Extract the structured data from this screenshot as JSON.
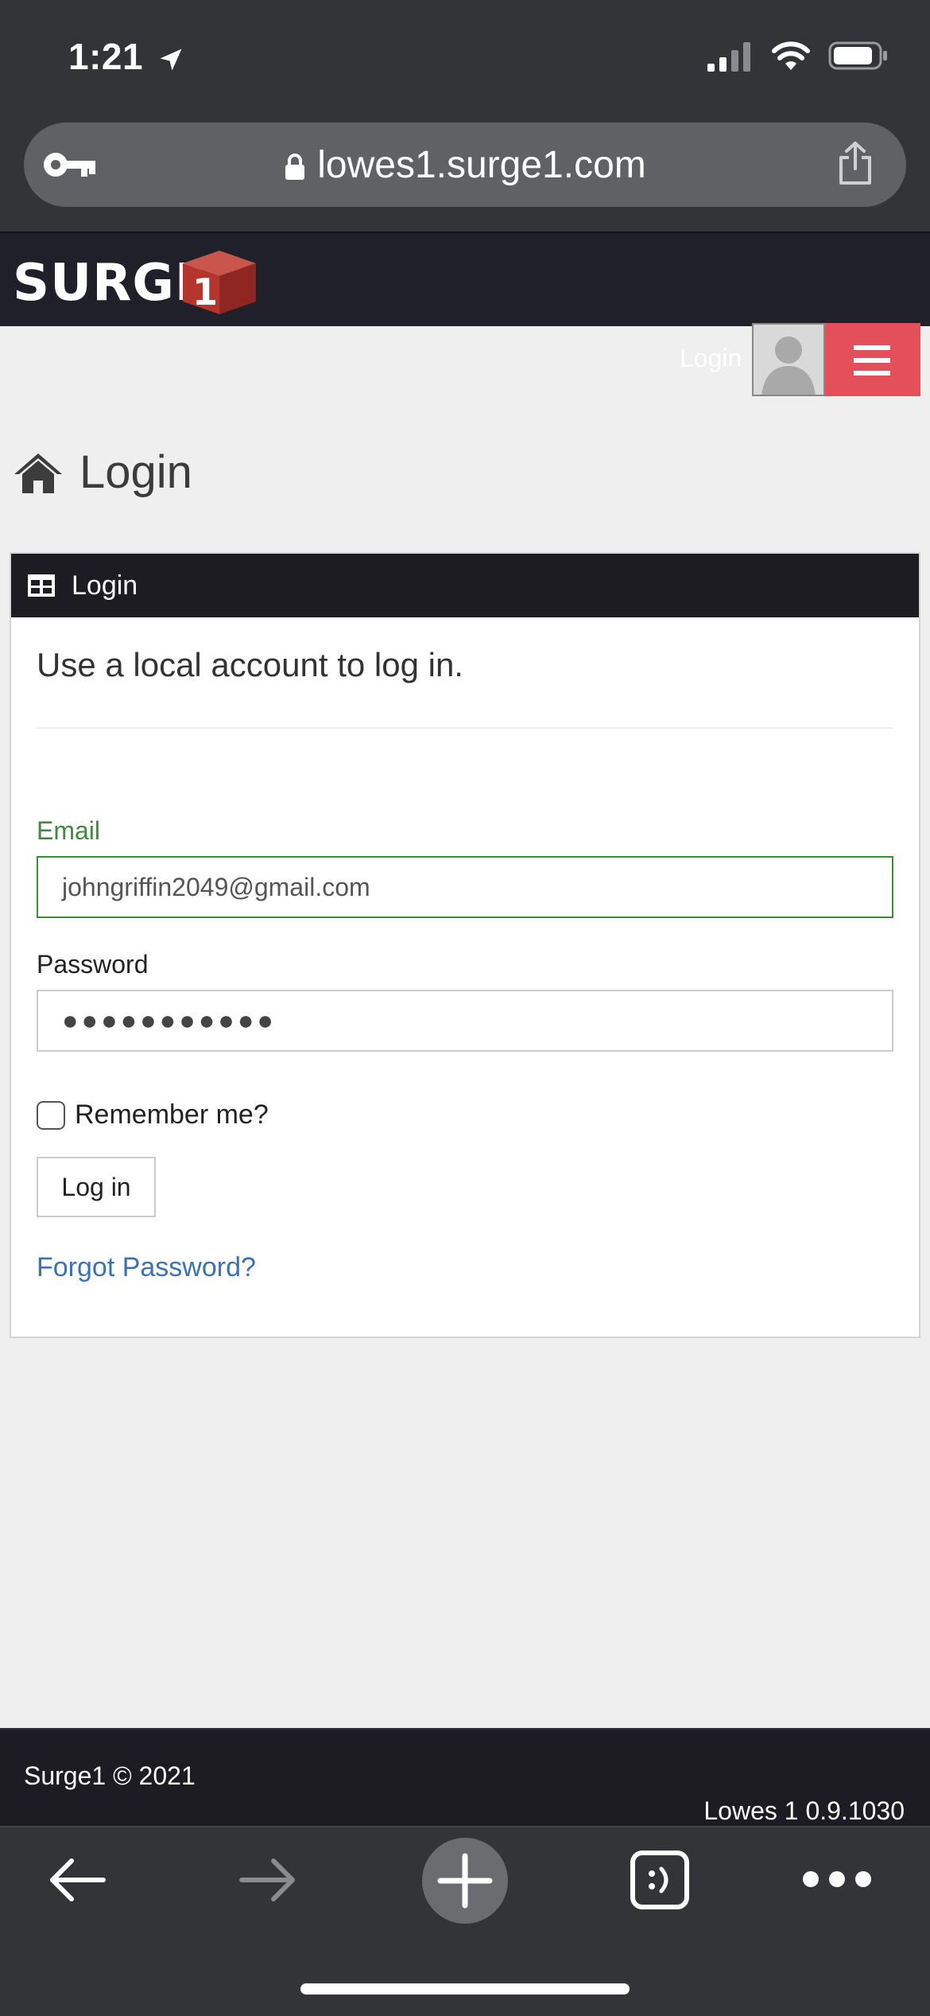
{
  "status_bar": {
    "time": "1:21"
  },
  "browser": {
    "url": "lowes1.surge1.com"
  },
  "site": {
    "logo_text": "SURGE",
    "logo_digit": "1"
  },
  "nav": {
    "login_link": "Login"
  },
  "page": {
    "title": "Login"
  },
  "panel": {
    "heading": "Login",
    "subtitle": "Use a local account to log in.",
    "email_label": "Email",
    "email_value": "johngriffin2049@gmail.com",
    "password_label": "Password",
    "password_value": "●●●●●●●●●●●",
    "remember_label": "Remember me?",
    "login_button": "Log in",
    "forgot_link": "Forgot Password?"
  },
  "footer": {
    "copyright": "Surge1 © 2021",
    "version": "Lowes 1 0.9.1030"
  },
  "colors": {
    "accent_red": "#e3505a",
    "header_dark": "#1f2029",
    "email_green": "#3f8a3b",
    "link_blue": "#3b72b0"
  },
  "icons": [
    "location-arrow-icon",
    "signal-icon",
    "wifi-icon",
    "battery-icon",
    "key-icon",
    "lock-icon",
    "share-icon",
    "cube-logo-icon",
    "avatar-icon",
    "hamburger-icon",
    "home-icon",
    "table-icon",
    "back-icon",
    "forward-icon",
    "new-tab-icon",
    "tabs-icon",
    "more-icon"
  ]
}
